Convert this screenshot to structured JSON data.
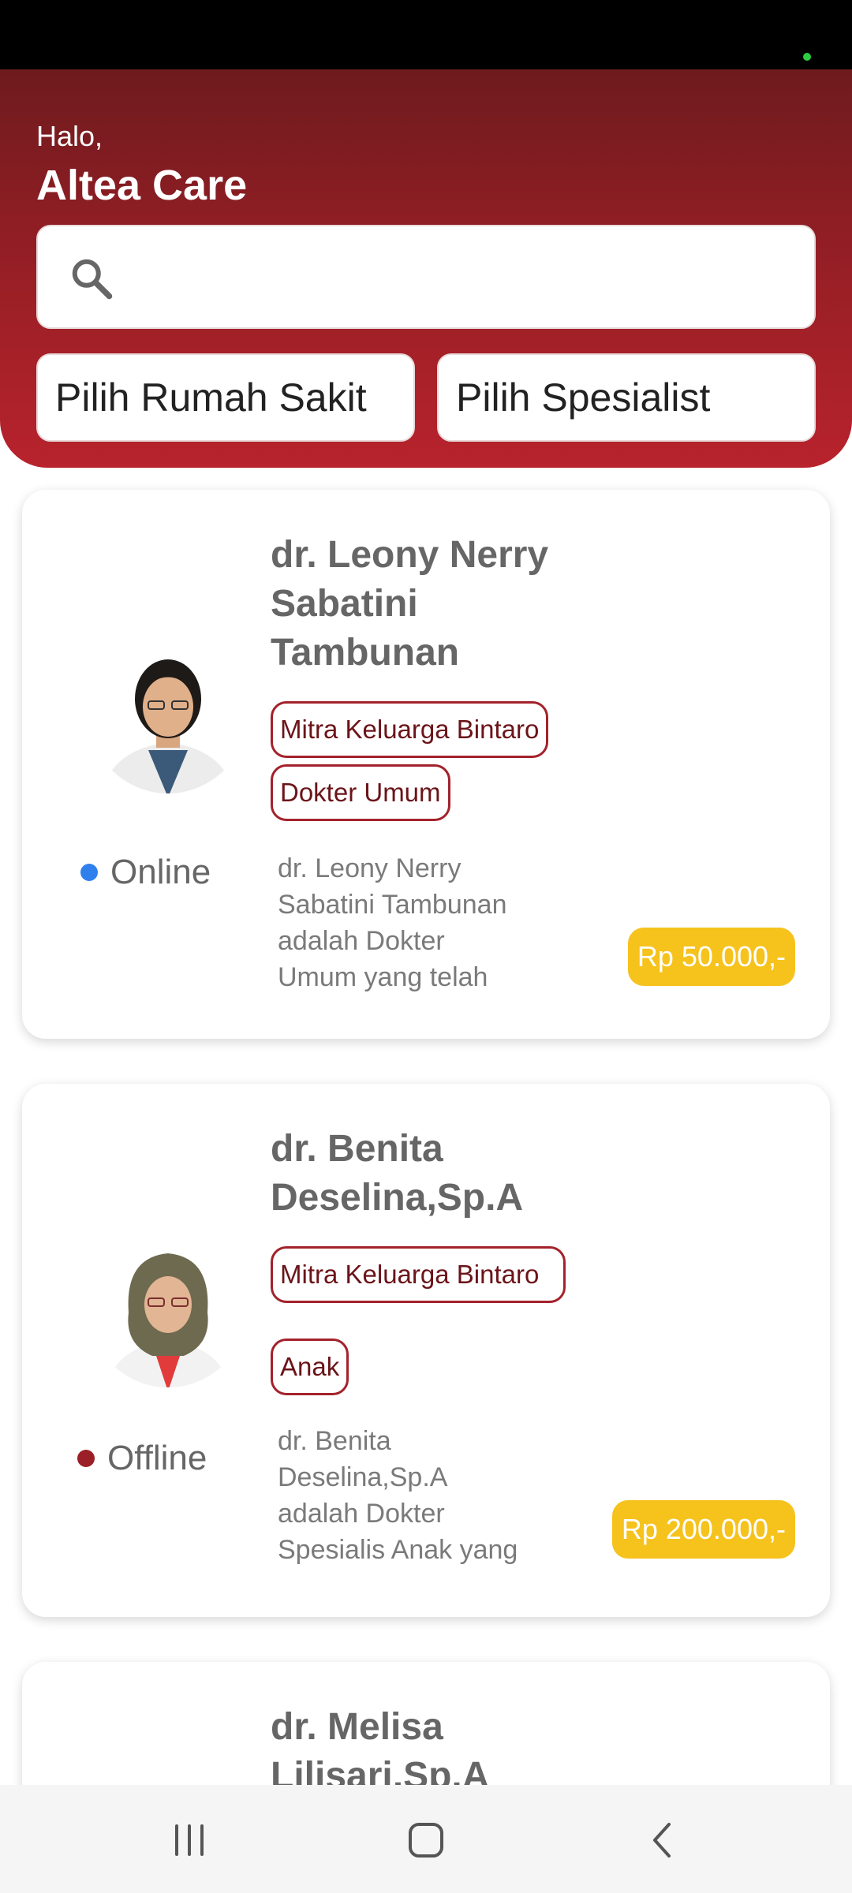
{
  "header": {
    "greeting": "Halo,",
    "user_name": "Altea Care",
    "search_placeholder": "",
    "filter_hospital": "Pilih Rumah Sakit",
    "filter_specialist": "Pilih Spesialist"
  },
  "doctors": [
    {
      "name": "dr. Leony Nerry Sabatini Tambunan",
      "hospital": "Mitra Keluarga Bintaro",
      "specialty": "Dokter Umum",
      "status": "Online",
      "description": " dr. Leony Nerry\nSabatini Tambunan\nadalah Dokter\nUmum yang telah",
      "price": "Rp 50.000,-"
    },
    {
      "name": "dr. Benita Deselina,Sp.A",
      "hospital": "Mitra Keluarga Bintaro",
      "specialty": "Anak",
      "status": "Offline",
      "description": " dr. Benita\nDeselina,Sp.A\nadalah Dokter\nSpesialis Anak yang",
      "price": "Rp 200.000,-"
    },
    {
      "name": "dr. Melisa Lilisari,Sp.A"
    }
  ],
  "colors": {
    "primary_dark": "#6e1b1e",
    "primary": "#b8232d",
    "price_badge": "#f6c21c",
    "online": "#2f80ed",
    "offline": "#9b1f26"
  },
  "icons": {
    "search": "search-icon",
    "nav_recents": "recents-icon",
    "nav_home": "home-icon",
    "nav_back": "back-icon"
  }
}
